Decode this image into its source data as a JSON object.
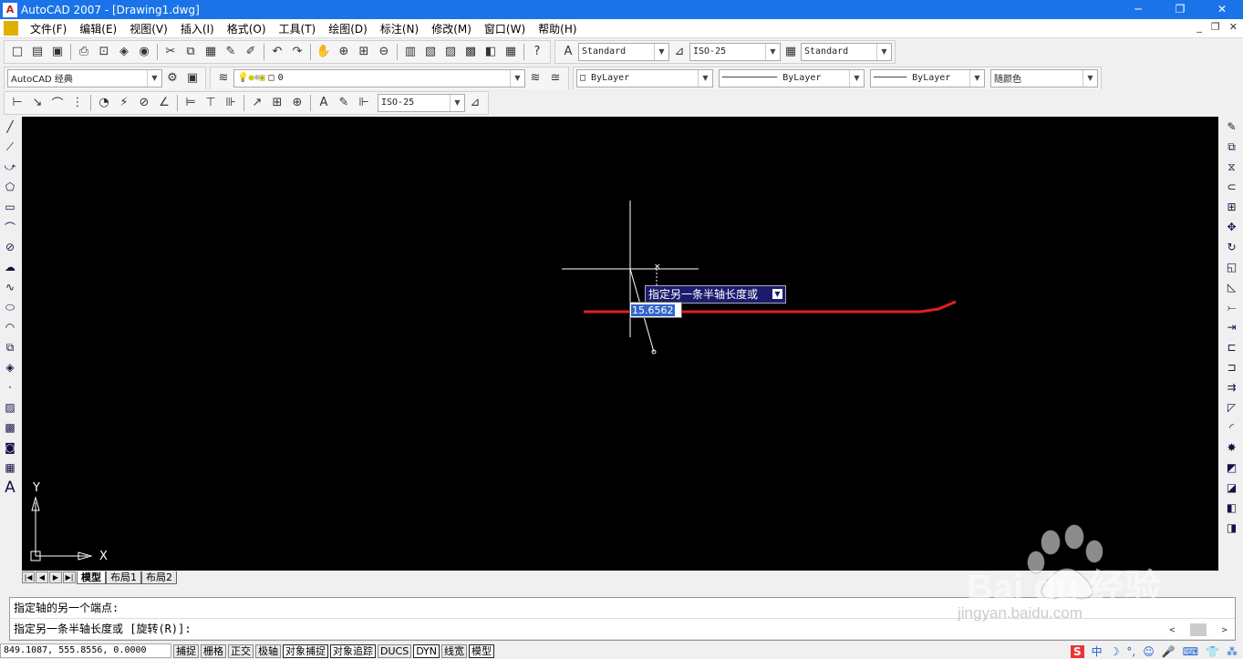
{
  "window": {
    "title": "AutoCAD 2007 - [Drawing1.dwg]",
    "min": "─",
    "restore": "❐",
    "close": "✕"
  },
  "menu": [
    "文件(F)",
    "编辑(E)",
    "视图(V)",
    "插入(I)",
    "格式(O)",
    "工具(T)",
    "绘图(D)",
    "标注(N)",
    "修改(M)",
    "窗口(W)",
    "帮助(H)"
  ],
  "mdi": {
    "min": "_",
    "restore": "❐",
    "close": "✕"
  },
  "styles": {
    "text_style": "Standard",
    "dim_style": "ISO-25",
    "table_style": "Standard"
  },
  "workspace": "AutoCAD 经典",
  "layer": "0",
  "properties": {
    "color": "ByLayer",
    "linetype": "ByLayer",
    "lineweight": "ByLayer",
    "plotstyle": "随颜色"
  },
  "dim_toolbar_style": "ISO-25",
  "tooltip": {
    "prompt": "指定另一条半轴长度或",
    "value": "15.6562"
  },
  "ucs": {
    "x": "X",
    "y": "Y"
  },
  "layout_tabs": [
    "模型",
    "布局1",
    "布局2"
  ],
  "command": {
    "line1": "指定轴的另一个端点:",
    "line2": "指定另一条半轴长度或 [旋转(R)]:"
  },
  "coords": "849.1087, 555.8556, 0.0000",
  "status_buttons": [
    {
      "label": "捕捉",
      "on": false
    },
    {
      "label": "栅格",
      "on": false
    },
    {
      "label": "正交",
      "on": false
    },
    {
      "label": "极轴",
      "on": false
    },
    {
      "label": "对象捕捉",
      "on": true
    },
    {
      "label": "对象追踪",
      "on": true
    },
    {
      "label": "DUCS",
      "on": false
    },
    {
      "label": "DYN",
      "on": true
    },
    {
      "label": "线宽",
      "on": false
    },
    {
      "label": "模型",
      "on": true
    }
  ],
  "tray_items": [
    "S",
    "中",
    "☽",
    "°,",
    "☺",
    "🎤",
    "⌨",
    "👕",
    "⁂"
  ],
  "watermark": {
    "brand": "Bai du 经验",
    "url": "jingyan.baidu.com"
  },
  "colors": {
    "canvas": "#000000",
    "red_line": "#e02020",
    "tooltip_bg": "#1c1c6e",
    "titlebar": "#1a73e8"
  }
}
